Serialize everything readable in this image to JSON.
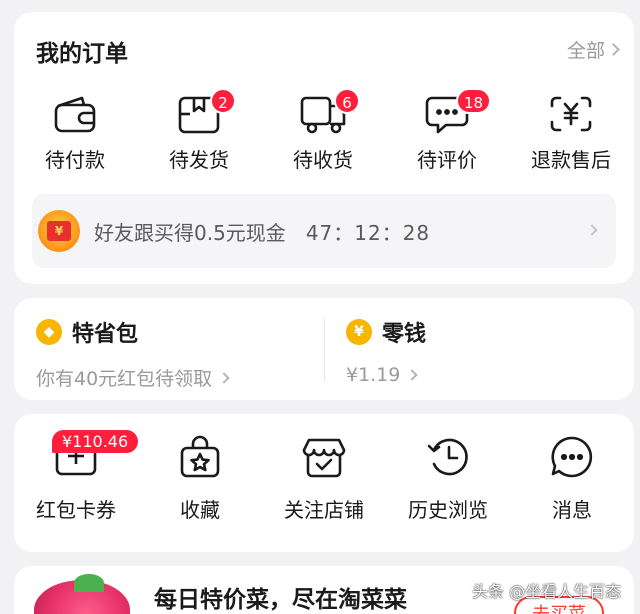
{
  "orders": {
    "title": "我的订单",
    "all_label": "全部",
    "items": [
      {
        "label": "待付款",
        "icon": "wallet-icon",
        "badge": ""
      },
      {
        "label": "待发货",
        "icon": "package-icon",
        "badge": "2"
      },
      {
        "label": "待收货",
        "icon": "truck-icon",
        "badge": "6"
      },
      {
        "label": "待评价",
        "icon": "comment-icon",
        "badge": "18"
      },
      {
        "label": "退款售后",
        "icon": "refund-icon",
        "badge": ""
      }
    ],
    "promo": {
      "text": "好友跟买得0.5元现金",
      "timer": "47：12：28",
      "icon": "red-envelope-icon"
    }
  },
  "wallet": {
    "savings": {
      "title": "特省包",
      "subtitle": "你有40元红包待领取",
      "icon": "diamond-coin-icon"
    },
    "change": {
      "title": "零钱",
      "subtitle": "¥1.19",
      "icon": "yen-coin-icon"
    }
  },
  "tools": {
    "items": [
      {
        "label": "红包卡券",
        "icon": "coupon-icon",
        "badge": "¥110.46"
      },
      {
        "label": "收藏",
        "icon": "favorite-bag-icon"
      },
      {
        "label": "关注店铺",
        "icon": "store-icon"
      },
      {
        "label": "历史浏览",
        "icon": "history-clock-icon"
      },
      {
        "label": "消息",
        "icon": "message-icon"
      }
    ]
  },
  "banner": {
    "title": "每日特价菜，尽在淘菜菜",
    "button": "去买菜"
  },
  "watermark": {
    "text": "头条 @坐看人生百态"
  },
  "colors": {
    "accent": "#ff1f3d",
    "coin": "#f7b500",
    "background": "#f2f2f4"
  }
}
